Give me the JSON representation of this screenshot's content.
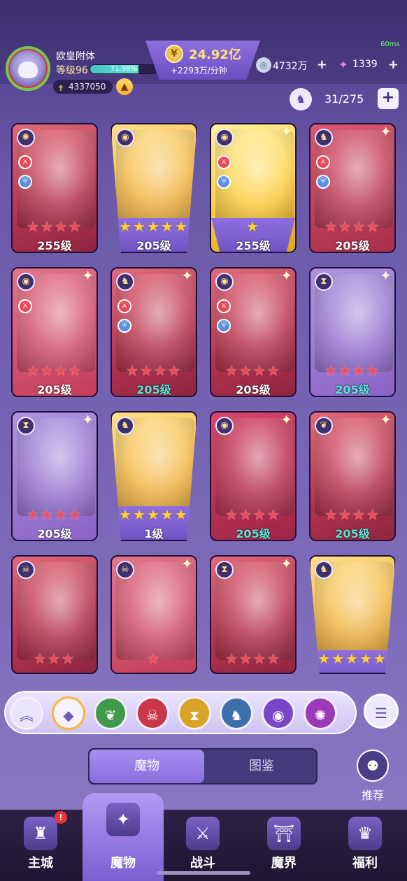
{
  "player": {
    "name": "欧皇附体",
    "level_label": "等级96",
    "xp_percent_label": "71.98%",
    "xp_fraction": 0.7198,
    "power": "4337050"
  },
  "currency": {
    "gold": "24.92亿",
    "gold_rate": "+2293万/分钟",
    "gem1": "4732万",
    "gem2": "1339"
  },
  "fps": "60ms",
  "roster": {
    "count": "31/275"
  },
  "cards": [
    {
      "level": "255级",
      "stars": "★★★★",
      "star_color": "red",
      "bg": "red",
      "level_teal": false,
      "sparkle": false,
      "badges": [
        "×",
        "shield"
      ]
    },
    {
      "level": "205级",
      "stars": "★★★★★",
      "star_color": "gold",
      "bg": "gold",
      "level_teal": false,
      "sparkle": false,
      "badges": []
    },
    {
      "level": "255级",
      "stars": "★",
      "star_color": "gold",
      "bg": "goldbright",
      "level_teal": false,
      "sparkle": true,
      "badges": [
        "×",
        "shield"
      ]
    },
    {
      "level": "205级",
      "stars": "★★★★",
      "star_color": "red",
      "bg": "red2",
      "level_teal": false,
      "sparkle": true,
      "badges": [
        "×",
        "shield"
      ]
    },
    {
      "level": "205级",
      "stars": "★★★★",
      "star_color": "red",
      "bg": "red3",
      "level_teal": false,
      "sparkle": true,
      "badges": [
        "×"
      ]
    },
    {
      "level": "205级",
      "stars": "★★★★",
      "star_color": "red",
      "bg": "red",
      "level_teal": true,
      "sparkle": true,
      "badges": [
        "×",
        "shield"
      ]
    },
    {
      "level": "205级",
      "stars": "★★★★",
      "star_color": "red",
      "bg": "red",
      "level_teal": false,
      "sparkle": true,
      "badges": [
        "×",
        "shield"
      ]
    },
    {
      "level": "205级",
      "stars": "★★★★",
      "star_color": "red",
      "bg": "purpleish",
      "level_teal": true,
      "sparkle": true,
      "badges": []
    },
    {
      "level": "205级",
      "stars": "★★★★",
      "star_color": "red",
      "bg": "purpleish",
      "level_teal": false,
      "sparkle": true,
      "badges": []
    },
    {
      "level": "1级",
      "stars": "★★★★★",
      "star_color": "gold",
      "bg": "gold",
      "level_teal": false,
      "sparkle": false,
      "badges": []
    },
    {
      "level": "205级",
      "stars": "★★★★",
      "star_color": "red",
      "bg": "red4",
      "level_teal": true,
      "sparkle": true,
      "badges": []
    },
    {
      "level": "205级",
      "stars": "★★★★",
      "star_color": "red",
      "bg": "red",
      "level_teal": true,
      "sparkle": true,
      "badges": []
    },
    {
      "level": "",
      "stars": "★★★",
      "star_color": "red",
      "bg": "red",
      "level_teal": false,
      "sparkle": false,
      "badges": []
    },
    {
      "level": "",
      "stars": "★",
      "star_color": "red",
      "bg": "red3",
      "level_teal": false,
      "sparkle": true,
      "badges": []
    },
    {
      "level": "",
      "stars": "★★★★",
      "star_color": "red",
      "bg": "red",
      "level_teal": false,
      "sparkle": true,
      "badges": []
    },
    {
      "level": "",
      "stars": "★★★★★",
      "star_color": "gold",
      "bg": "gold",
      "level_teal": false,
      "sparkle": false,
      "badges": []
    }
  ],
  "filters": [
    {
      "icon": "collapse-up-icon",
      "glyph": "︽",
      "style": "up",
      "color": ""
    },
    {
      "icon": "all-factions-icon",
      "glyph": "◆",
      "style": "all",
      "color": ""
    },
    {
      "icon": "nature-faction-icon",
      "glyph": "❦",
      "style": "faction",
      "color": "#3f9a4c"
    },
    {
      "icon": "demon-faction-icon",
      "glyph": "☠",
      "style": "faction",
      "color": "#c8384a"
    },
    {
      "icon": "hourglass-faction-icon",
      "glyph": "⧗",
      "style": "faction",
      "color": "#d9a326"
    },
    {
      "icon": "dragon-faction-icon",
      "glyph": "♞",
      "style": "faction",
      "color": "#3d6fa8"
    },
    {
      "icon": "eye-faction-icon",
      "glyph": "◉",
      "style": "faction",
      "color": "#7a46c8"
    },
    {
      "icon": "vortex-faction-icon",
      "glyph": "✺",
      "style": "faction",
      "color": "#9a3ab6"
    }
  ],
  "tabs": {
    "monsters": "魔物",
    "codex": "图鉴"
  },
  "recommend": "推荐",
  "nav": [
    {
      "label": "主城",
      "glyph": "♜",
      "badge": "!",
      "active": false
    },
    {
      "label": "魔物",
      "glyph": "✦",
      "badge": "",
      "active": true
    },
    {
      "label": "战斗",
      "glyph": "⚔",
      "badge": "",
      "active": false
    },
    {
      "label": "魔界",
      "glyph": "⛩",
      "badge": "",
      "active": false
    },
    {
      "label": "福利",
      "glyph": "♛",
      "badge": "",
      "active": false
    }
  ],
  "colors": {
    "accent": "#8b6fe0",
    "teal_level": "#59e6d8",
    "red_star": "#f04b59",
    "gold_star": "#ffd233"
  }
}
